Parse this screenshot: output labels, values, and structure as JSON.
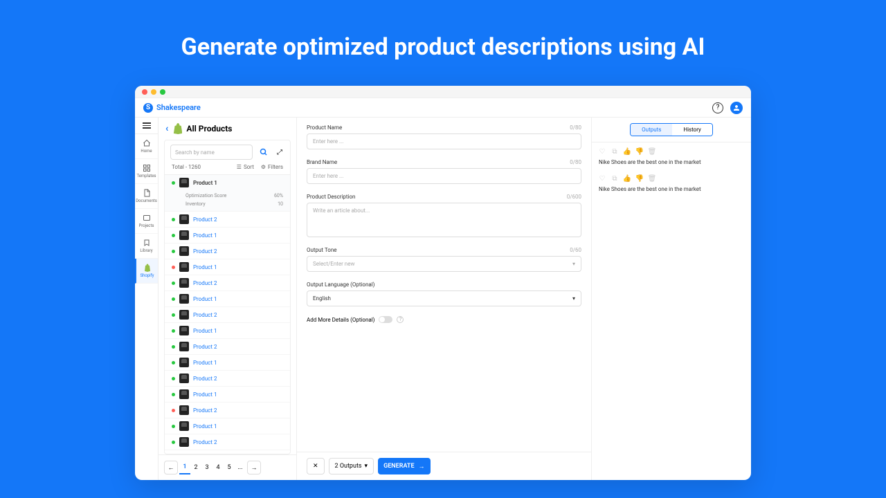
{
  "hero": {
    "title": "Generate optimized product descriptions using AI"
  },
  "app": {
    "name": "Shakespeare"
  },
  "sidebar": {
    "items": [
      {
        "label": "Home"
      },
      {
        "label": "Templates"
      },
      {
        "label": "Documents"
      },
      {
        "label": "Projects"
      },
      {
        "label": "Library"
      },
      {
        "label": "Shopify"
      }
    ]
  },
  "products": {
    "title": "All Products",
    "search_placeholder": "Search by name",
    "total_label": "Total - 1260",
    "sort_label": "Sort",
    "filters_label": "Filters",
    "expanded": {
      "name": "Product 1",
      "opt_label": "Optimization Score",
      "opt_value": "60%",
      "inv_label": "Inventory",
      "inv_value": "10"
    },
    "list": [
      {
        "dot": "green",
        "name": "Product 2"
      },
      {
        "dot": "green",
        "name": "Product 1"
      },
      {
        "dot": "green",
        "name": "Product 2"
      },
      {
        "dot": "red",
        "name": "Product 1"
      },
      {
        "dot": "green",
        "name": "Product 2"
      },
      {
        "dot": "green",
        "name": "Product 1"
      },
      {
        "dot": "green",
        "name": "Product 2"
      },
      {
        "dot": "green",
        "name": "Product 1"
      },
      {
        "dot": "green",
        "name": "Product 2"
      },
      {
        "dot": "green",
        "name": "Product 1"
      },
      {
        "dot": "green",
        "name": "Product 2"
      },
      {
        "dot": "green",
        "name": "Product 1"
      },
      {
        "dot": "red",
        "name": "Product 2"
      },
      {
        "dot": "green",
        "name": "Product 1"
      },
      {
        "dot": "green",
        "name": "Product 2"
      }
    ],
    "pages": [
      "1",
      "2",
      "3",
      "4",
      "5",
      "..."
    ]
  },
  "form": {
    "product_name": {
      "label": "Product Name",
      "counter": "0/80",
      "placeholder": "Enter here ..."
    },
    "brand_name": {
      "label": "Brand Name",
      "counter": "0/80",
      "placeholder": "Enter here ..."
    },
    "description": {
      "label": "Product Description",
      "counter": "0/600",
      "placeholder": "Write an article about..."
    },
    "tone": {
      "label": "Output Tone",
      "counter": "0/60",
      "placeholder": "Select/Enter new"
    },
    "language": {
      "label": "Output Language (Optional)",
      "value": "English"
    },
    "more_details": {
      "label": "Add More Details (Optional)"
    },
    "outputs_count": "2 Outputs",
    "generate": "GENERATE"
  },
  "outputs": {
    "tabs": {
      "outputs": "Outputs",
      "history": "History"
    },
    "cards": [
      {
        "text": "Nike Shoes are the best one in the market"
      },
      {
        "text": "Nike Shoes are the best one in the market"
      }
    ]
  }
}
